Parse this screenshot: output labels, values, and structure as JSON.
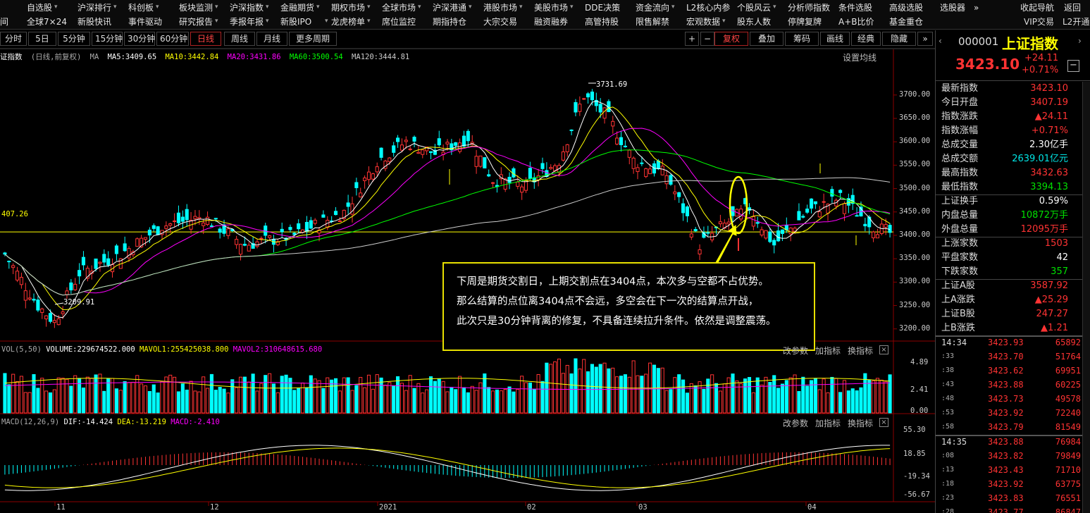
{
  "nav": {
    "row1": [
      {
        "label": "自选股",
        "caret": true
      },
      {
        "label": "沪深排行",
        "caret": true
      },
      {
        "label": "科创板",
        "caret": true
      },
      {
        "label": "板块监测",
        "caret": true
      },
      {
        "label": "沪深指数",
        "caret": true
      },
      {
        "label": "金融期货",
        "caret": true
      },
      {
        "label": "期权市场",
        "caret": true
      },
      {
        "label": "全球市场",
        "caret": true
      },
      {
        "label": "沪深港通",
        "caret": true
      },
      {
        "label": "港股市场",
        "caret": true
      },
      {
        "label": "美股市场",
        "caret": true
      },
      {
        "label": "DDE决策",
        "caret": false
      },
      {
        "label": "资金流向",
        "caret": true
      },
      {
        "label": "L2核心内参",
        "caret": false
      },
      {
        "label": "个股风云",
        "caret": true
      },
      {
        "label": "分析师指数",
        "caret": false
      },
      {
        "label": "条件选股",
        "caret": false
      },
      {
        "label": "高级选股",
        "caret": false
      },
      {
        "label": "选股器",
        "caret": false
      },
      {
        "label": "»",
        "caret": false
      }
    ],
    "row1_right": [
      "收起导航",
      "返回"
    ],
    "row2": [
      {
        "label": "间",
        "caret": false
      },
      {
        "label": "全球7×24",
        "caret": false
      },
      {
        "label": "新股快讯",
        "caret": false
      },
      {
        "label": "事件驱动",
        "caret": false
      },
      {
        "label": "研究报告",
        "caret": true
      },
      {
        "label": "季报年报",
        "caret": true
      },
      {
        "label": "新股IPO",
        "caret": true
      },
      {
        "label": "龙虎榜单",
        "caret": true
      },
      {
        "label": "席位监控",
        "caret": false
      },
      {
        "label": "期指持仓",
        "caret": false
      },
      {
        "label": "大宗交易",
        "caret": false
      },
      {
        "label": "融资融券",
        "caret": false
      },
      {
        "label": "高管持股",
        "caret": false
      },
      {
        "label": "限售解禁",
        "caret": false
      },
      {
        "label": "宏观数据",
        "caret": true
      },
      {
        "label": "股东人数",
        "caret": false
      },
      {
        "label": "停牌复牌",
        "caret": false
      },
      {
        "label": "A+B比价",
        "caret": false
      },
      {
        "label": "基金重仓",
        "caret": false
      }
    ],
    "row2_right": [
      "VIP交易",
      "L2开通"
    ]
  },
  "toolbar": {
    "periods": [
      "分时",
      "5日",
      "5分钟",
      "15分钟",
      "30分钟",
      "60分钟",
      "日线",
      "周线",
      "月线",
      "更多周期"
    ],
    "active_period": "日线",
    "right_buttons": [
      "+",
      "−",
      "复权",
      "叠加",
      "筹码",
      "画线",
      "经典",
      "隐藏",
      "»"
    ]
  },
  "legend": {
    "title": "证指数",
    "subtitle": "(日线,前复权)",
    "ma_label": "MA",
    "ma5": "MA5:3409.65",
    "ma10": "MA10:3442.84",
    "ma20": "MA20:3431.86",
    "ma60": "MA60:3500.54",
    "ma120": "MA120:3444.81",
    "settings": "设置均线"
  },
  "price_axis": [
    "3700.00",
    "3650.00",
    "3600.00",
    "3550.00",
    "3500.00",
    "3450.00",
    "3400.00",
    "3350.00",
    "3300.00",
    "3250.00",
    "3200.00"
  ],
  "ref_price": "407.26",
  "max_label": "3731.69",
  "min_label": "3209.91",
  "annotation": [
    "下周是期货交割日，上期交割点在3404点，本次多与空都不占优势。",
    "那么结算的点位离3404点不会远，多空会在下一次的结算点开战，",
    "此次只是30分钟背离的修复，不具备连续拉升条件。依然是调整震荡。"
  ],
  "volume": {
    "label": "VOL(5,50)",
    "volume": "VOLUME:229674522.000",
    "mavol1": "MAVOL1:255425038.800",
    "mavol2": "MAVOL2:310648615.680",
    "buttons": [
      "改参数",
      "加指标",
      "换指标"
    ],
    "axis": [
      "4.89",
      "2.41",
      "0.00"
    ]
  },
  "macd": {
    "label": "MACD(12,26,9)",
    "dif": "DIF:-14.424",
    "dea": "DEA:-13.219",
    "macd": "MACD:-2.410",
    "buttons": [
      "改参数",
      "加指标",
      "换指标"
    ],
    "axis": [
      "55.30",
      "18.85",
      "-19.34",
      "-56.67"
    ]
  },
  "date_axis": [
    "11",
    "12",
    "2021",
    "02",
    "03",
    "04"
  ],
  "quote": {
    "code": "000001",
    "name": "上证指数",
    "price": "3423.10",
    "change": "+24.11",
    "change_pct": "+0.71%",
    "rows": [
      {
        "label": "最新指数",
        "value": "3423.10",
        "color": "#ff3333"
      },
      {
        "label": "今日开盘",
        "value": "3407.19",
        "color": "#ff3333"
      },
      {
        "label": "指数涨跌",
        "value": "▲24.11",
        "color": "#ff3333"
      },
      {
        "label": "指数涨幅",
        "value": "+0.71%",
        "color": "#ff3333"
      },
      {
        "label": "总成交量",
        "value": "2.30亿手",
        "color": "#ffffff"
      },
      {
        "label": "总成交额",
        "value": "2639.01亿元",
        "color": "#00e5e5"
      },
      {
        "label": "最高指数",
        "value": "3432.63",
        "color": "#ff3333"
      },
      {
        "label": "最低指数",
        "value": "3394.13",
        "color": "#00e000"
      },
      {
        "label": "上证换手",
        "value": "0.59%",
        "color": "#ffffff"
      },
      {
        "label": "内盘总量",
        "value": "10872万手",
        "color": "#00e000"
      },
      {
        "label": "外盘总量",
        "value": "12095万手",
        "color": "#ff3333"
      },
      {
        "label": "上涨家数",
        "value": "1503",
        "color": "#ff3333"
      },
      {
        "label": "平盘家数",
        "value": "42",
        "color": "#ffffff"
      },
      {
        "label": "下跌家数",
        "value": "357",
        "color": "#00e000"
      },
      {
        "label": "上证A股",
        "value": "3587.92",
        "color": "#ff3333"
      },
      {
        "label": "上A涨跌",
        "value": "▲25.29",
        "color": "#ff3333"
      },
      {
        "label": "上证B股",
        "value": "247.27",
        "color": "#ff3333"
      },
      {
        "label": "上B涨跌",
        "value": "▲1.21",
        "color": "#ff3333"
      }
    ]
  },
  "ticks": {
    "group1": [
      {
        "time": "14:34",
        "price": "3423.93",
        "vol": "65892"
      },
      {
        "time": ":33",
        "price": "3423.70",
        "vol": "51764"
      },
      {
        "time": ":38",
        "price": "3423.62",
        "vol": "69951"
      },
      {
        "time": ":43",
        "price": "3423.88",
        "vol": "60225"
      },
      {
        "time": ":48",
        "price": "3423.73",
        "vol": "49578"
      },
      {
        "time": ":53",
        "price": "3423.92",
        "vol": "72240"
      },
      {
        "time": ":58",
        "price": "3423.79",
        "vol": "81549"
      }
    ],
    "group2": [
      {
        "time": "14:35",
        "price": "3423.88",
        "vol": "76984"
      },
      {
        "time": ":08",
        "price": "3423.82",
        "vol": "79849"
      },
      {
        "time": ":13",
        "price": "3423.43",
        "vol": "71710"
      },
      {
        "time": ":18",
        "price": "3423.92",
        "vol": "63775"
      },
      {
        "time": ":23",
        "price": "3423.83",
        "vol": "76551"
      },
      {
        "time": ":28",
        "price": "3423.77",
        "vol": "86847"
      }
    ]
  },
  "colors": {
    "up": "#ff3333",
    "down": "#00ffff",
    "ma5": "#ffffff",
    "ma10": "#ffff00",
    "ma20": "#ff00ff",
    "ma60": "#00ff00",
    "ma120": "#cccccc"
  }
}
